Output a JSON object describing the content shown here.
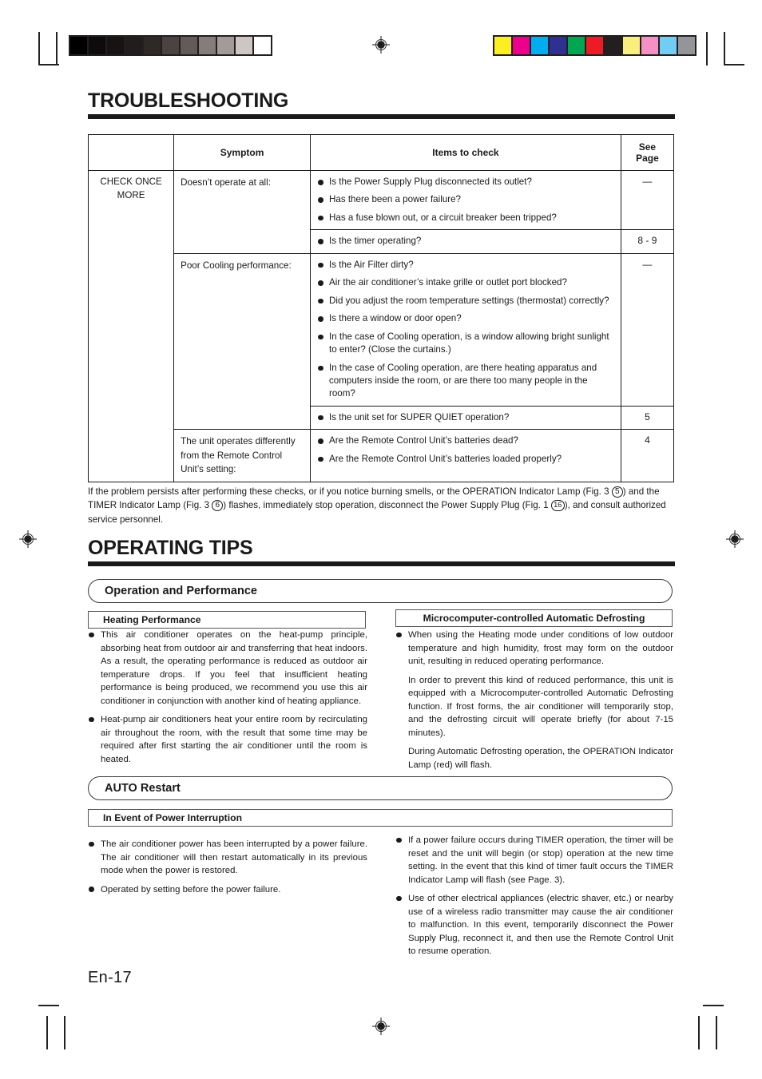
{
  "marks": {
    "gray_bar_label": "grayscale-calibration-bar",
    "color_bar_label": "color-calibration-bar",
    "gray_swatches": [
      "#000000",
      "#0d0b0b",
      "#161312",
      "#211d1c",
      "#2e2926",
      "#4a4341",
      "#635b58",
      "#857d7a",
      "#a39b98",
      "#cec6c2",
      "#ffffff"
    ],
    "color_swatches": [
      "#fcee21",
      "#ec008c",
      "#00aeef",
      "#2e3192",
      "#00a651",
      "#ed1c24",
      "#231f20",
      "#faee7d",
      "#f490c4",
      "#72cdf4",
      "#939598"
    ]
  },
  "troubleshooting": {
    "heading": "TROUBLESHOOTING",
    "table": {
      "headers": [
        "",
        "Symptom",
        "Items to check",
        "See Page"
      ],
      "check_label": "CHECK ONCE MORE",
      "rows": [
        {
          "symptom": "Doesn’t operate at all:",
          "groups": [
            {
              "items": [
                "Is the Power Supply Plug disconnected its outlet?",
                "Has there been a power failure?",
                "Has a fuse blown out, or a circuit breaker been tripped?"
              ],
              "page": "—"
            },
            {
              "items": [
                "Is the timer operating?"
              ],
              "page": "8 - 9"
            }
          ]
        },
        {
          "symptom": "Poor Cooling performance:",
          "groups": [
            {
              "items": [
                "Is the Air Filter dirty?",
                "Air the air conditioner’s intake grille or outlet port blocked?",
                "Did you adjust the room temperature settings (thermostat) correctly?",
                "Is there a window or door open?",
                "In the case of Cooling operation, is a window allowing bright sunlight to enter? (Close the curtains.)",
                "In the case of Cooling operation, are there heating apparatus and computers inside the room, or are there too many people in the room?"
              ],
              "page": "—"
            },
            {
              "items": [
                "Is the unit set for SUPER QUIET operation?"
              ],
              "page": "5"
            }
          ]
        },
        {
          "symptom": "The unit operates differently from the Remote Control Unit’s setting:",
          "groups": [
            {
              "items": [
                "Are the Remote Control Unit’s batteries dead?",
                "Are the Remote Control Unit’s batteries loaded properly?"
              ],
              "page": "4"
            }
          ]
        }
      ]
    },
    "note": {
      "part1": "If the problem persists after performing these checks, or if you notice burning smells, or the OPERATION Indicator Lamp (Fig. 3 ",
      "num1": "5",
      "part2": ") and  the TIMER Indicator Lamp (Fig. 3 ",
      "num2": "6",
      "part3": ") flashes, immediately stop operation, disconnect the Power Supply Plug (Fig. 1 ",
      "num3": "16",
      "part4": "), and consult authorized service personnel."
    }
  },
  "operating_tips": {
    "heading": "OPERATING TIPS",
    "section1": {
      "bar_title": "Operation and Performance",
      "left": {
        "sub_title": "Heating Performance",
        "bullets": [
          "This air conditioner operates on the heat-pump principle, absorbing heat from outdoor air and transferring that heat indoors. As a result, the operating performance is reduced as outdoor air temperature drops. If you feel that insufficient heating performance is being produced, we recommend you use this air conditioner in conjunction with another kind of heating appliance.",
          "Heat-pump air conditioners heat your entire room by recirculating air throughout the room, with the result that some time may be required after first starting the air conditioner until the room is heated."
        ]
      },
      "right": {
        "sub_title": "Microcomputer-controlled Automatic Defrosting",
        "bullets": [
          "When using the Heating mode under conditions of low outdoor temperature and high humidity, frost may form on the outdoor unit, resulting in reduced operating performance."
        ],
        "paragraphs": [
          "In order to prevent this kind of reduced performance, this unit is equipped with a Microcomputer-controlled Automatic Defrosting function. If frost forms, the air conditioner will temporarily stop, and the defrosting circuit will operate briefly (for about 7-15 minutes).",
          "During Automatic Defrosting operation, the OPERATION Indicator Lamp (red) will flash."
        ]
      }
    },
    "section2": {
      "bar_title": "AUTO Restart",
      "sub_title": "In Event of Power Interruption",
      "left_bullets": [
        "The air conditioner power has been interrupted by a power failure. The air conditioner will then restart automatically in its previous mode when the power is restored.",
        "Operated by setting before the power failure."
      ],
      "right_bullets": [
        "If a power failure occurs during TIMER operation, the timer will be reset and the unit will begin (or stop) operation at the new time setting. In the event that this kind of timer fault occurs the TIMER Indicator Lamp will flash (see Page. 3).",
        "Use of other electrical appliances (electric shaver, etc.) or nearby use of a wireless radio transmitter may cause the air conditioner to malfunction. In this event, temporarily disconnect the Power Supply Plug, reconnect it, and then use the Remote Control Unit to resume operation."
      ]
    }
  },
  "footer": {
    "page_number": "En-17"
  }
}
